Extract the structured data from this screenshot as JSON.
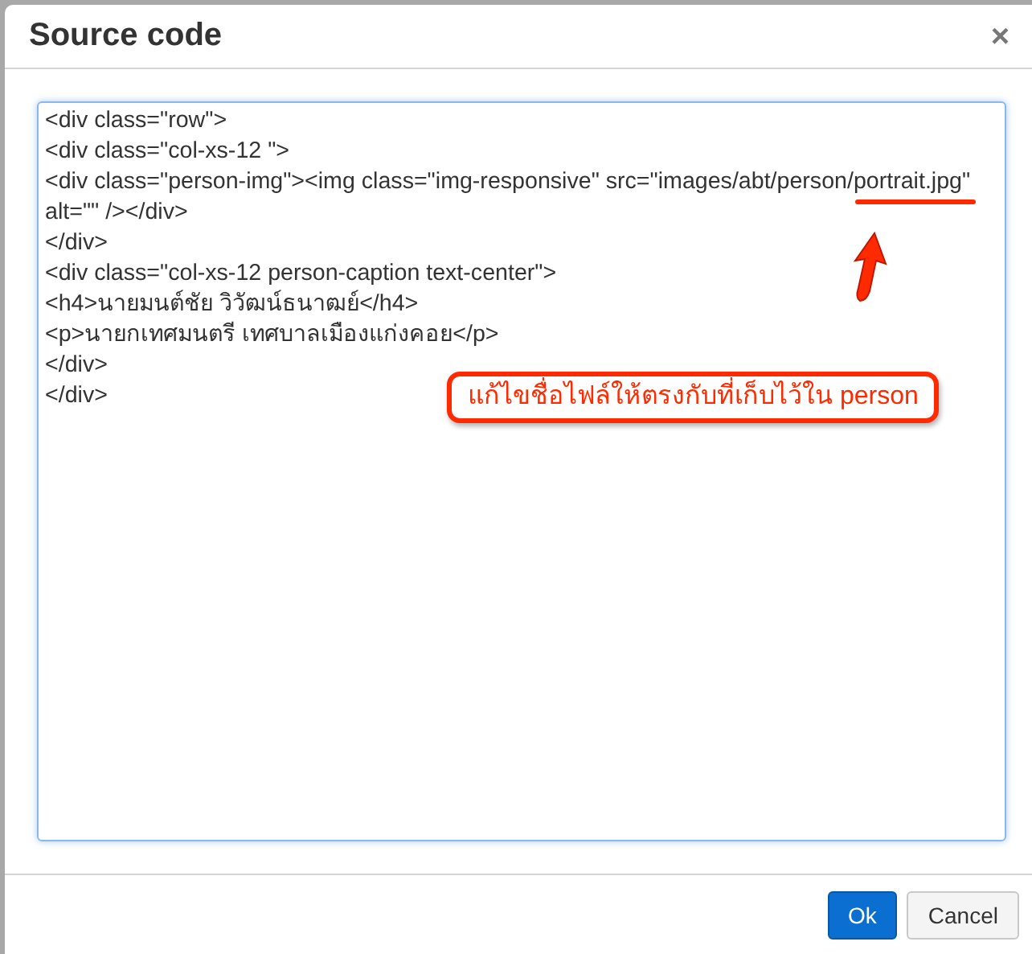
{
  "dialog": {
    "title": "Source code",
    "close": "×"
  },
  "code_lines": [
    "<div class=\"row\">",
    "<div class=\"col-xs-12 \">",
    "<div class=\"person-img\"><img class=\"img-responsive\" src=\"images/abt/person/portrait.jpg\"",
    "alt=\"\" /></div>",
    "</div>",
    "<div class=\"col-xs-12 person-caption text-center\">",
    "<h4>นายมนต์ชัย วิวัฒน์ธนาฒย์</h4>",
    "<p>นายกเทศมนตรี เทศบาลเมืองแก่งคอย</p>",
    "</div>",
    "</div>"
  ],
  "annotation": {
    "text": "แก้ไขชื่อไฟล์ให้ตรงกับที่เก็บไว้ใน person"
  },
  "buttons": [
    {
      "label": "Ok",
      "kind": "primary"
    },
    {
      "label": "Cancel",
      "kind": "default"
    }
  ]
}
